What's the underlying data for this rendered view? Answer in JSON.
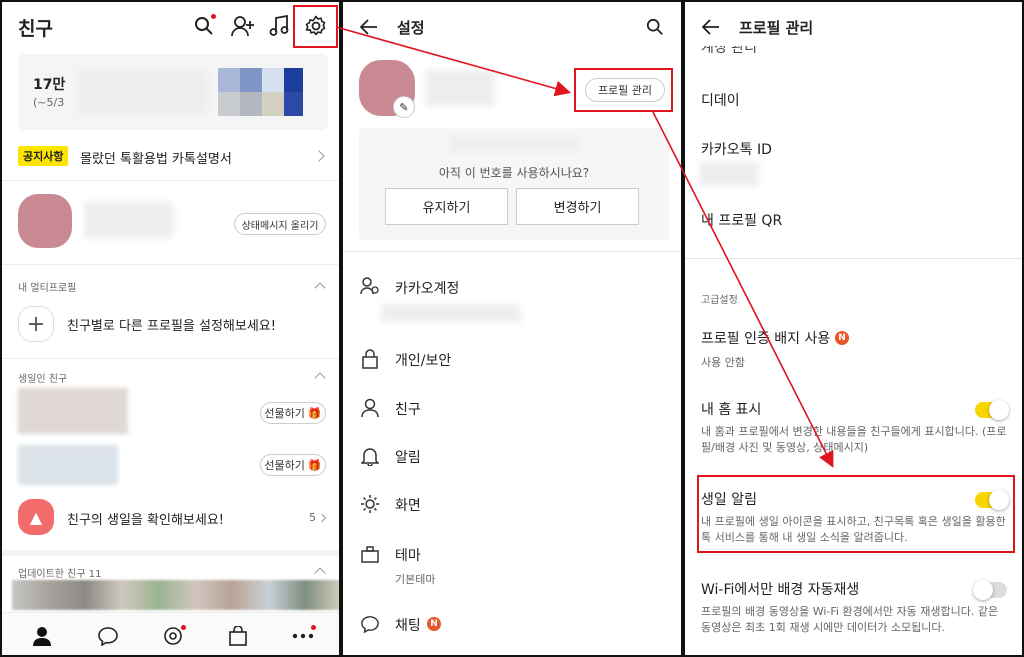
{
  "p1": {
    "title": "친구",
    "banner_count": "17만",
    "banner_sub": "(~5/3",
    "notice_badge": "공지사항",
    "notice_text": "몰랐던 톡활용법 카톡설명서",
    "status_btn": "상태메시지 올리기",
    "multi_section": "내 멀티프로필",
    "multi_text": "친구별로 다른 프로필을 설정해보세요!",
    "bday_section": "생일인 친구",
    "gift_btn": "선물하기",
    "bday_check": "친구의 생일을 확인해보세요!",
    "bday_count": "5",
    "updated_section": "업데이트한 친구 11",
    "accent": "#e0151d"
  },
  "p2": {
    "title": "설정",
    "profile_manage": "프로필 관리",
    "phone_question": "아직 이 번호를 사용하시나요?",
    "keep_btn": "유지하기",
    "change_btn": "변경하기",
    "menu": [
      {
        "label": "카카오계정",
        "icon": "account-icon"
      },
      {
        "label": "개인/보안",
        "icon": "lock-icon"
      },
      {
        "label": "친구",
        "icon": "person-icon"
      },
      {
        "label": "알림",
        "icon": "bell-icon"
      },
      {
        "label": "화면",
        "icon": "brightness-icon"
      },
      {
        "label": "테마",
        "icon": "theme-icon",
        "sub": "기본테마"
      },
      {
        "label": "채팅",
        "icon": "chat-icon",
        "badge": "N"
      }
    ]
  },
  "p3": {
    "title": "프로필 관리",
    "partial_top": "계정 관리",
    "items": [
      "디데이",
      "카카오톡 ID",
      "내 프로필 QR"
    ],
    "advanced": "고급설정",
    "badge_title": "프로필 인증 배지 사용",
    "badge_sub": "사용 안함",
    "home_title": "내 홈 표시",
    "home_desc": "내 홈과 프로필에서 변경한 내용들을 친구들에게 표시합니다. (프로필/배경 사진 및 동영상, 상태메시지)",
    "bday_title": "생일 알림",
    "bday_desc": "내 프로필에 생일 아이콘을 표시하고, 친구목록 혹은 생일을 활용한 톡 서비스를 통해 내 생일 소식을 알려줍니다.",
    "wifi_title": "Wi-Fi에서만 배경 자동재생",
    "wifi_desc": "프로필의 배경 동영상을 Wi-Fi 환경에서만 자동 재생합니다. 같은 동영상은 최초 1회 재생 시에만 데이터가 소모됩니다.",
    "toggle_on": "#f7d600",
    "toggle_off": "#dddddd"
  }
}
